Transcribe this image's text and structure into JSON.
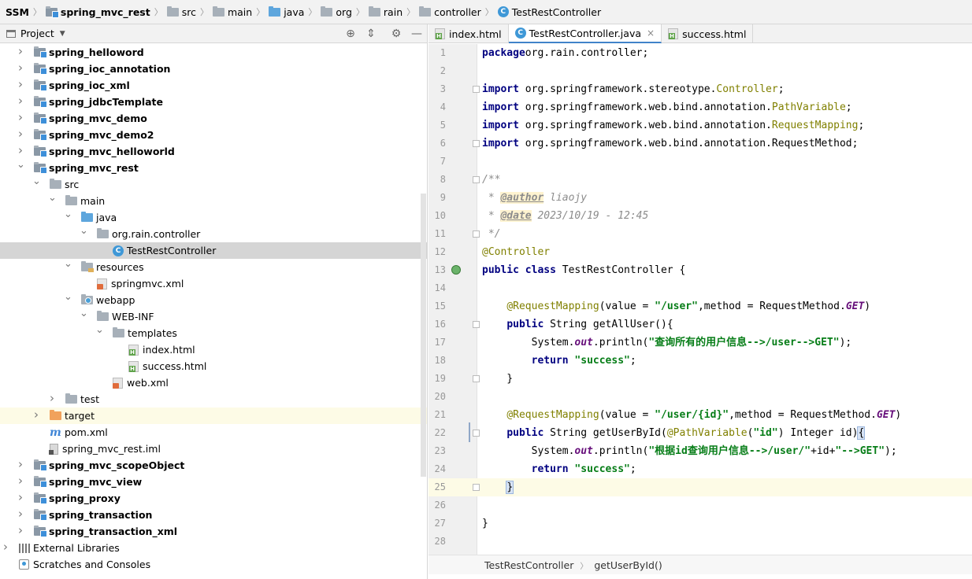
{
  "breadcrumb": [
    {
      "label": "SSM",
      "icon": "none",
      "bold": true
    },
    {
      "label": "spring_mvc_rest",
      "icon": "module-folder-icon",
      "bold": true
    },
    {
      "label": "src",
      "icon": "folder-icon",
      "bold": false
    },
    {
      "label": "main",
      "icon": "folder-icon",
      "bold": false
    },
    {
      "label": "java",
      "icon": "source-folder-icon",
      "bold": false
    },
    {
      "label": "org",
      "icon": "package-icon",
      "bold": false
    },
    {
      "label": "rain",
      "icon": "package-icon",
      "bold": false
    },
    {
      "label": "controller",
      "icon": "package-icon",
      "bold": false
    },
    {
      "label": "TestRestController",
      "icon": "class-icon",
      "bold": false
    }
  ],
  "project_panel": {
    "title": "Project",
    "tree": [
      {
        "label": "spring_helloword",
        "icon": "module",
        "depth": 0,
        "arrow": "right",
        "bold": true
      },
      {
        "label": "spring_ioc_annotation",
        "icon": "module",
        "depth": 0,
        "arrow": "right",
        "bold": true
      },
      {
        "label": "spring_ioc_xml",
        "icon": "module",
        "depth": 0,
        "arrow": "right",
        "bold": true
      },
      {
        "label": "spring_jdbcTemplate",
        "icon": "module",
        "depth": 0,
        "arrow": "right",
        "bold": true
      },
      {
        "label": "spring_mvc_demo",
        "icon": "module",
        "depth": 0,
        "arrow": "right",
        "bold": true
      },
      {
        "label": "spring_mvc_demo2",
        "icon": "module",
        "depth": 0,
        "arrow": "right",
        "bold": true
      },
      {
        "label": "spring_mvc_helloworld",
        "icon": "module",
        "depth": 0,
        "arrow": "right",
        "bold": true
      },
      {
        "label": "spring_mvc_rest",
        "icon": "module",
        "depth": 0,
        "arrow": "down",
        "bold": true
      },
      {
        "label": "src",
        "icon": "folder",
        "depth": 1,
        "arrow": "down",
        "bold": false
      },
      {
        "label": "main",
        "icon": "folder",
        "depth": 2,
        "arrow": "down",
        "bold": false
      },
      {
        "label": "java",
        "icon": "src",
        "depth": 3,
        "arrow": "down",
        "bold": false
      },
      {
        "label": "org.rain.controller",
        "icon": "package",
        "depth": 4,
        "arrow": "down",
        "bold": false
      },
      {
        "label": "TestRestController",
        "icon": "class",
        "depth": 5,
        "arrow": "none",
        "bold": false,
        "selected": true
      },
      {
        "label": "resources",
        "icon": "res",
        "depth": 3,
        "arrow": "down",
        "bold": false
      },
      {
        "label": "springmvc.xml",
        "icon": "xml",
        "depth": 4,
        "arrow": "none",
        "bold": false
      },
      {
        "label": "webapp",
        "icon": "web",
        "depth": 3,
        "arrow": "down",
        "bold": false
      },
      {
        "label": "WEB-INF",
        "icon": "folder",
        "depth": 4,
        "arrow": "down",
        "bold": false
      },
      {
        "label": "templates",
        "icon": "folder",
        "depth": 5,
        "arrow": "down",
        "bold": false
      },
      {
        "label": "index.html",
        "icon": "html",
        "depth": 6,
        "arrow": "none",
        "bold": false
      },
      {
        "label": "success.html",
        "icon": "html",
        "depth": 6,
        "arrow": "none",
        "bold": false
      },
      {
        "label": "web.xml",
        "icon": "xml",
        "depth": 5,
        "arrow": "none",
        "bold": false
      },
      {
        "label": "test",
        "icon": "folder",
        "depth": 2,
        "arrow": "right",
        "bold": false
      },
      {
        "label": "target",
        "icon": "target",
        "depth": 1,
        "arrow": "right",
        "bold": false,
        "highlight": true
      },
      {
        "label": "pom.xml",
        "icon": "maven",
        "depth": 1,
        "arrow": "none",
        "bold": false
      },
      {
        "label": "spring_mvc_rest.iml",
        "icon": "iml",
        "depth": 1,
        "arrow": "none",
        "bold": false
      },
      {
        "label": "spring_mvc_scopeObject",
        "icon": "module",
        "depth": 0,
        "arrow": "right",
        "bold": true
      },
      {
        "label": "spring_mvc_view",
        "icon": "module",
        "depth": 0,
        "arrow": "right",
        "bold": true
      },
      {
        "label": "spring_proxy",
        "icon": "module",
        "depth": 0,
        "arrow": "right",
        "bold": true
      },
      {
        "label": "spring_transaction",
        "icon": "module",
        "depth": 0,
        "arrow": "right",
        "bold": true
      },
      {
        "label": "spring_transaction_xml",
        "icon": "module",
        "depth": 0,
        "arrow": "right",
        "bold": true
      },
      {
        "label": "External Libraries",
        "icon": "lib",
        "depth": -1,
        "arrow": "right",
        "bold": false
      },
      {
        "label": "Scratches and Consoles",
        "icon": "scratch",
        "depth": -1,
        "arrow": "none",
        "bold": false
      }
    ]
  },
  "editor": {
    "tabs": [
      {
        "label": "index.html",
        "icon": "html",
        "active": false,
        "closable": false
      },
      {
        "label": "TestRestController.java",
        "icon": "class",
        "active": true,
        "closable": true
      },
      {
        "label": "success.html",
        "icon": "html",
        "active": false,
        "closable": false
      }
    ],
    "current_line": 25,
    "lines": [
      [
        [
          "kw",
          "package"
        ],
        [
          "",
          "org.rain.controller;"
        ]
      ],
      [],
      [
        [
          "kw",
          "import"
        ],
        [
          "",
          " org.springframework.stereotype."
        ],
        [
          "ann",
          "Controller"
        ],
        [
          "",
          ";"
        ]
      ],
      [
        [
          "kw",
          "import"
        ],
        [
          "",
          " org.springframework.web.bind.annotation."
        ],
        [
          "ann",
          "PathVariable"
        ],
        [
          "",
          ";"
        ]
      ],
      [
        [
          "kw",
          "import"
        ],
        [
          "",
          " org.springframework.web.bind.annotation."
        ],
        [
          "ann",
          "RequestMapping"
        ],
        [
          "",
          ";"
        ]
      ],
      [
        [
          "kw",
          "import"
        ],
        [
          "",
          " org.springframework.web.bind.annotation.RequestMethod;"
        ]
      ],
      [],
      [
        [
          "cmt",
          "/**"
        ]
      ],
      [
        [
          "cmt",
          " * "
        ],
        [
          "tag",
          "@author"
        ],
        [
          "cmt",
          " liaojy"
        ]
      ],
      [
        [
          "cmt",
          " * "
        ],
        [
          "tag",
          "@date"
        ],
        [
          "cmt",
          " 2023/10/19 - 12:45"
        ]
      ],
      [
        [
          "cmt",
          " */"
        ]
      ],
      [
        [
          "ann",
          "@Controller"
        ]
      ],
      [
        [
          "kw",
          "public class"
        ],
        [
          "",
          " TestRestController {"
        ]
      ],
      [],
      [
        [
          "",
          "    "
        ],
        [
          "ann",
          "@RequestMapping"
        ],
        [
          "",
          "(value = "
        ],
        [
          "str",
          "\"/user\""
        ],
        [
          "",
          ",method = RequestMethod."
        ],
        [
          "stat",
          "GET"
        ],
        [
          "",
          ")"
        ]
      ],
      [
        [
          "",
          "    "
        ],
        [
          "kw",
          "public"
        ],
        [
          "",
          " String getAllUser(){"
        ]
      ],
      [
        [
          "",
          "        System."
        ],
        [
          "stat",
          "out"
        ],
        [
          "",
          ".println("
        ],
        [
          "str",
          "\"查询所有的用户信息-->/user-->GET\""
        ],
        [
          "",
          ");"
        ]
      ],
      [
        [
          "",
          "        "
        ],
        [
          "kw",
          "return"
        ],
        [
          "",
          " "
        ],
        [
          "str",
          "\"success\""
        ],
        [
          "",
          ";"
        ]
      ],
      [
        [
          "",
          "    }"
        ]
      ],
      [],
      [
        [
          "",
          "    "
        ],
        [
          "ann",
          "@RequestMapping"
        ],
        [
          "",
          "(value = "
        ],
        [
          "str",
          "\"/user/{id}\""
        ],
        [
          "",
          ",method = RequestMethod."
        ],
        [
          "stat",
          "GET"
        ],
        [
          "",
          ")"
        ]
      ],
      [
        [
          "",
          "    "
        ],
        [
          "kw",
          "public"
        ],
        [
          "",
          " String getUserById("
        ],
        [
          "ann",
          "@PathVariable"
        ],
        [
          "",
          "("
        ],
        [
          "str",
          "\"id\""
        ],
        [
          "",
          ") Integer id)"
        ],
        [
          "cursor",
          "{"
        ]
      ],
      [
        [
          "",
          "        System."
        ],
        [
          "stat",
          "out"
        ],
        [
          "",
          ".println("
        ],
        [
          "str",
          "\"根据id查询用户信息-->/user/\""
        ],
        [
          "",
          "+id+"
        ],
        [
          "str",
          "\"-->GET\""
        ],
        [
          "",
          ");"
        ]
      ],
      [
        [
          "",
          "        "
        ],
        [
          "kw",
          "return"
        ],
        [
          "",
          " "
        ],
        [
          "str",
          "\"success\""
        ],
        [
          "",
          ";"
        ]
      ],
      [
        [
          "",
          "    "
        ],
        [
          "cursor",
          "}"
        ]
      ],
      [],
      [
        [
          "",
          "}"
        ]
      ],
      []
    ],
    "fold_lines": [
      3,
      6,
      8,
      11,
      16,
      19,
      22,
      25
    ],
    "bean_line": 13,
    "bottom_breadcrumb": [
      "TestRestController",
      "getUserById()"
    ]
  },
  "colors": {
    "keyword": "#000080",
    "annotation": "#808000",
    "string": "#067d17",
    "comment": "#8c8c8c",
    "selection": "#d5d5d5",
    "current_line": "#fdfbe6",
    "tab_underline": "#4083c9"
  }
}
